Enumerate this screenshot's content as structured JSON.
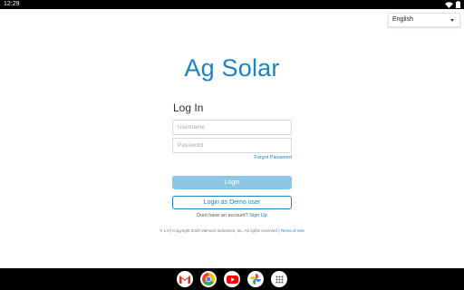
{
  "status_bar": {
    "time": "12:29"
  },
  "language": {
    "selected": "English"
  },
  "app": {
    "title": "Ag Solar"
  },
  "login": {
    "heading": "Log In",
    "username_placeholder": "Username",
    "password_placeholder": "Password",
    "forgot_label": "Forgot Password",
    "login_label": "Login",
    "demo_label": "Login as Demo user",
    "no_account_text": "Dont have an account?",
    "signup_label": "Sign Up"
  },
  "footer": {
    "text": "V 1.0 | Copyright 2020 Valmont Industries, Inc. All rights reserved |",
    "terms_label": "Terms of Use"
  },
  "dock": {
    "apps": [
      "gmail-icon",
      "chrome-icon",
      "youtube-icon",
      "photos-icon",
      "app-drawer-icon"
    ]
  },
  "colors": {
    "brand": "#1f82c0",
    "login_button": "#8cc7e8"
  }
}
